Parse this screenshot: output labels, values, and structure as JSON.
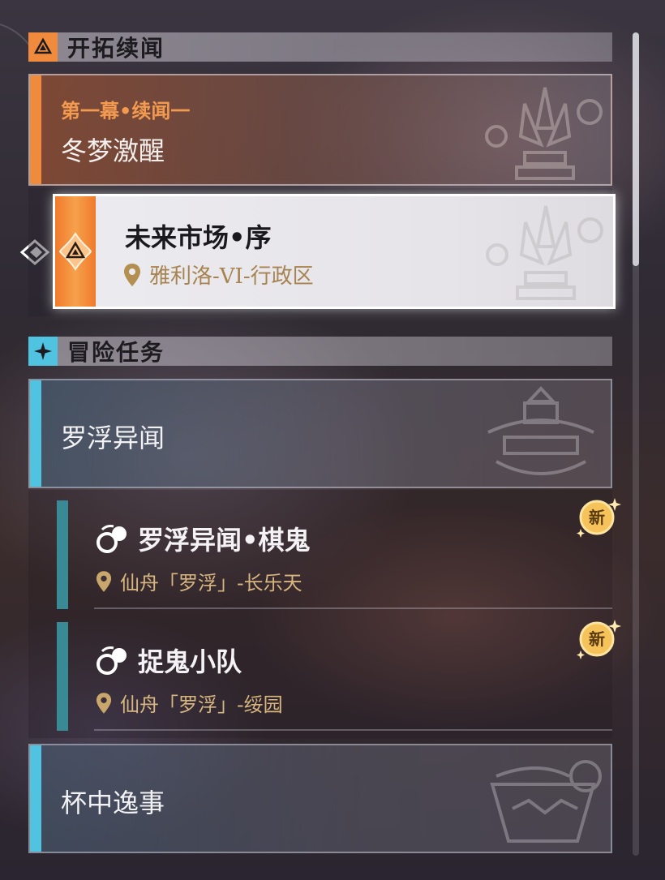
{
  "sections": {
    "trailblaze": {
      "title": "开拓续闻"
    },
    "adventure": {
      "title": "冒险任务"
    }
  },
  "trailblaze_group": {
    "subtitle": "第一幕•续闻一",
    "title": "冬梦激醒"
  },
  "selected_quest": {
    "title": "未来市场•序",
    "location": "雅利洛-VI-行政区"
  },
  "adventure_groups": [
    {
      "title": "罗浮异闻"
    },
    {
      "title": "杯中逸事"
    }
  ],
  "adventure_quests": [
    {
      "title": "罗浮异闻•棋鬼",
      "location": "仙舟「罗浮」-长乐天",
      "badge": "新"
    },
    {
      "title": "捉鬼小队",
      "location": "仙舟「罗浮」-绥园",
      "badge": "新"
    }
  ],
  "colors": {
    "trailblaze_accent": "#f08a3c",
    "adventure_accent": "#4fc3e0",
    "location_gold": "#c9a66b"
  }
}
